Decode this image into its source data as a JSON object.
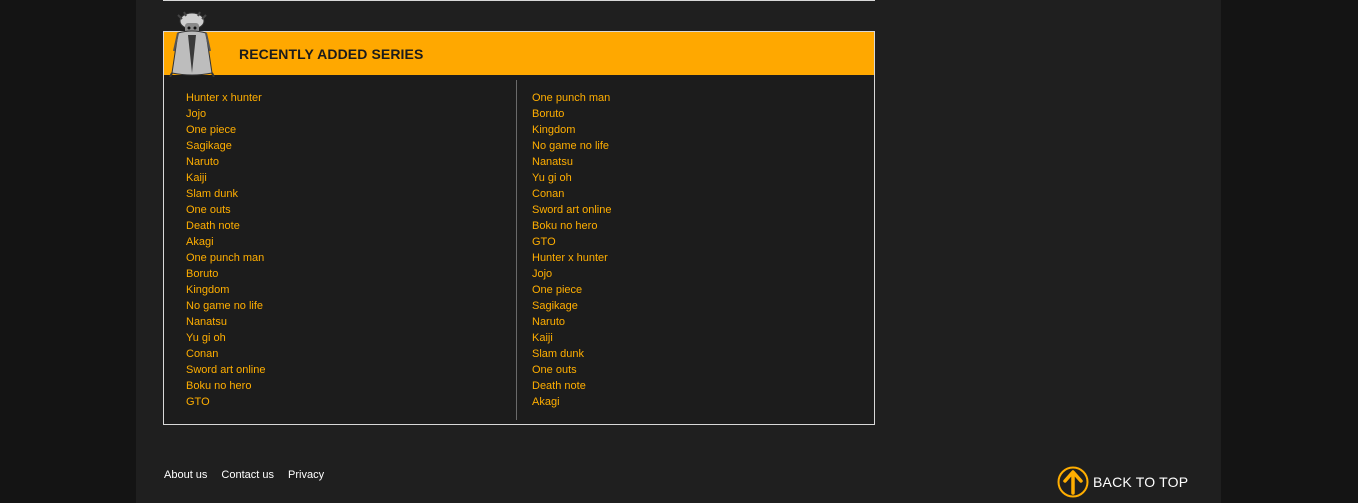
{
  "panel": {
    "title": "RECENTLY ADDED SERIES",
    "accent_color": "#ffa800",
    "link_color": "#ffae00",
    "mascot_icon": "robed-figure-mascot-icon"
  },
  "series": {
    "left": [
      "Hunter x hunter",
      "Jojo",
      "One piece",
      "Sagikage",
      "Naruto",
      "Kaiji",
      "Slam dunk",
      "One outs",
      "Death note",
      "Akagi",
      "One punch man",
      "Boruto",
      "Kingdom",
      "No game no life",
      "Nanatsu",
      "Yu gi oh",
      "Conan",
      "Sword art online",
      "Boku no hero",
      "GTO"
    ],
    "right": [
      "One punch man",
      "Boruto",
      "Kingdom",
      "No game no life",
      "Nanatsu",
      "Yu gi oh",
      "Conan",
      "Sword art online",
      "Boku no hero",
      "GTO",
      "Hunter x hunter",
      "Jojo",
      "One piece",
      "Sagikage",
      "Naruto",
      "Kaiji",
      "Slam dunk",
      "One outs",
      "Death note",
      "Akagi"
    ]
  },
  "footer": {
    "about": "About us",
    "contact": "Contact us",
    "privacy": "Privacy",
    "back_to_top": "BACK TO TOP",
    "back_to_top_icon": "arrow-up-circle-icon"
  }
}
